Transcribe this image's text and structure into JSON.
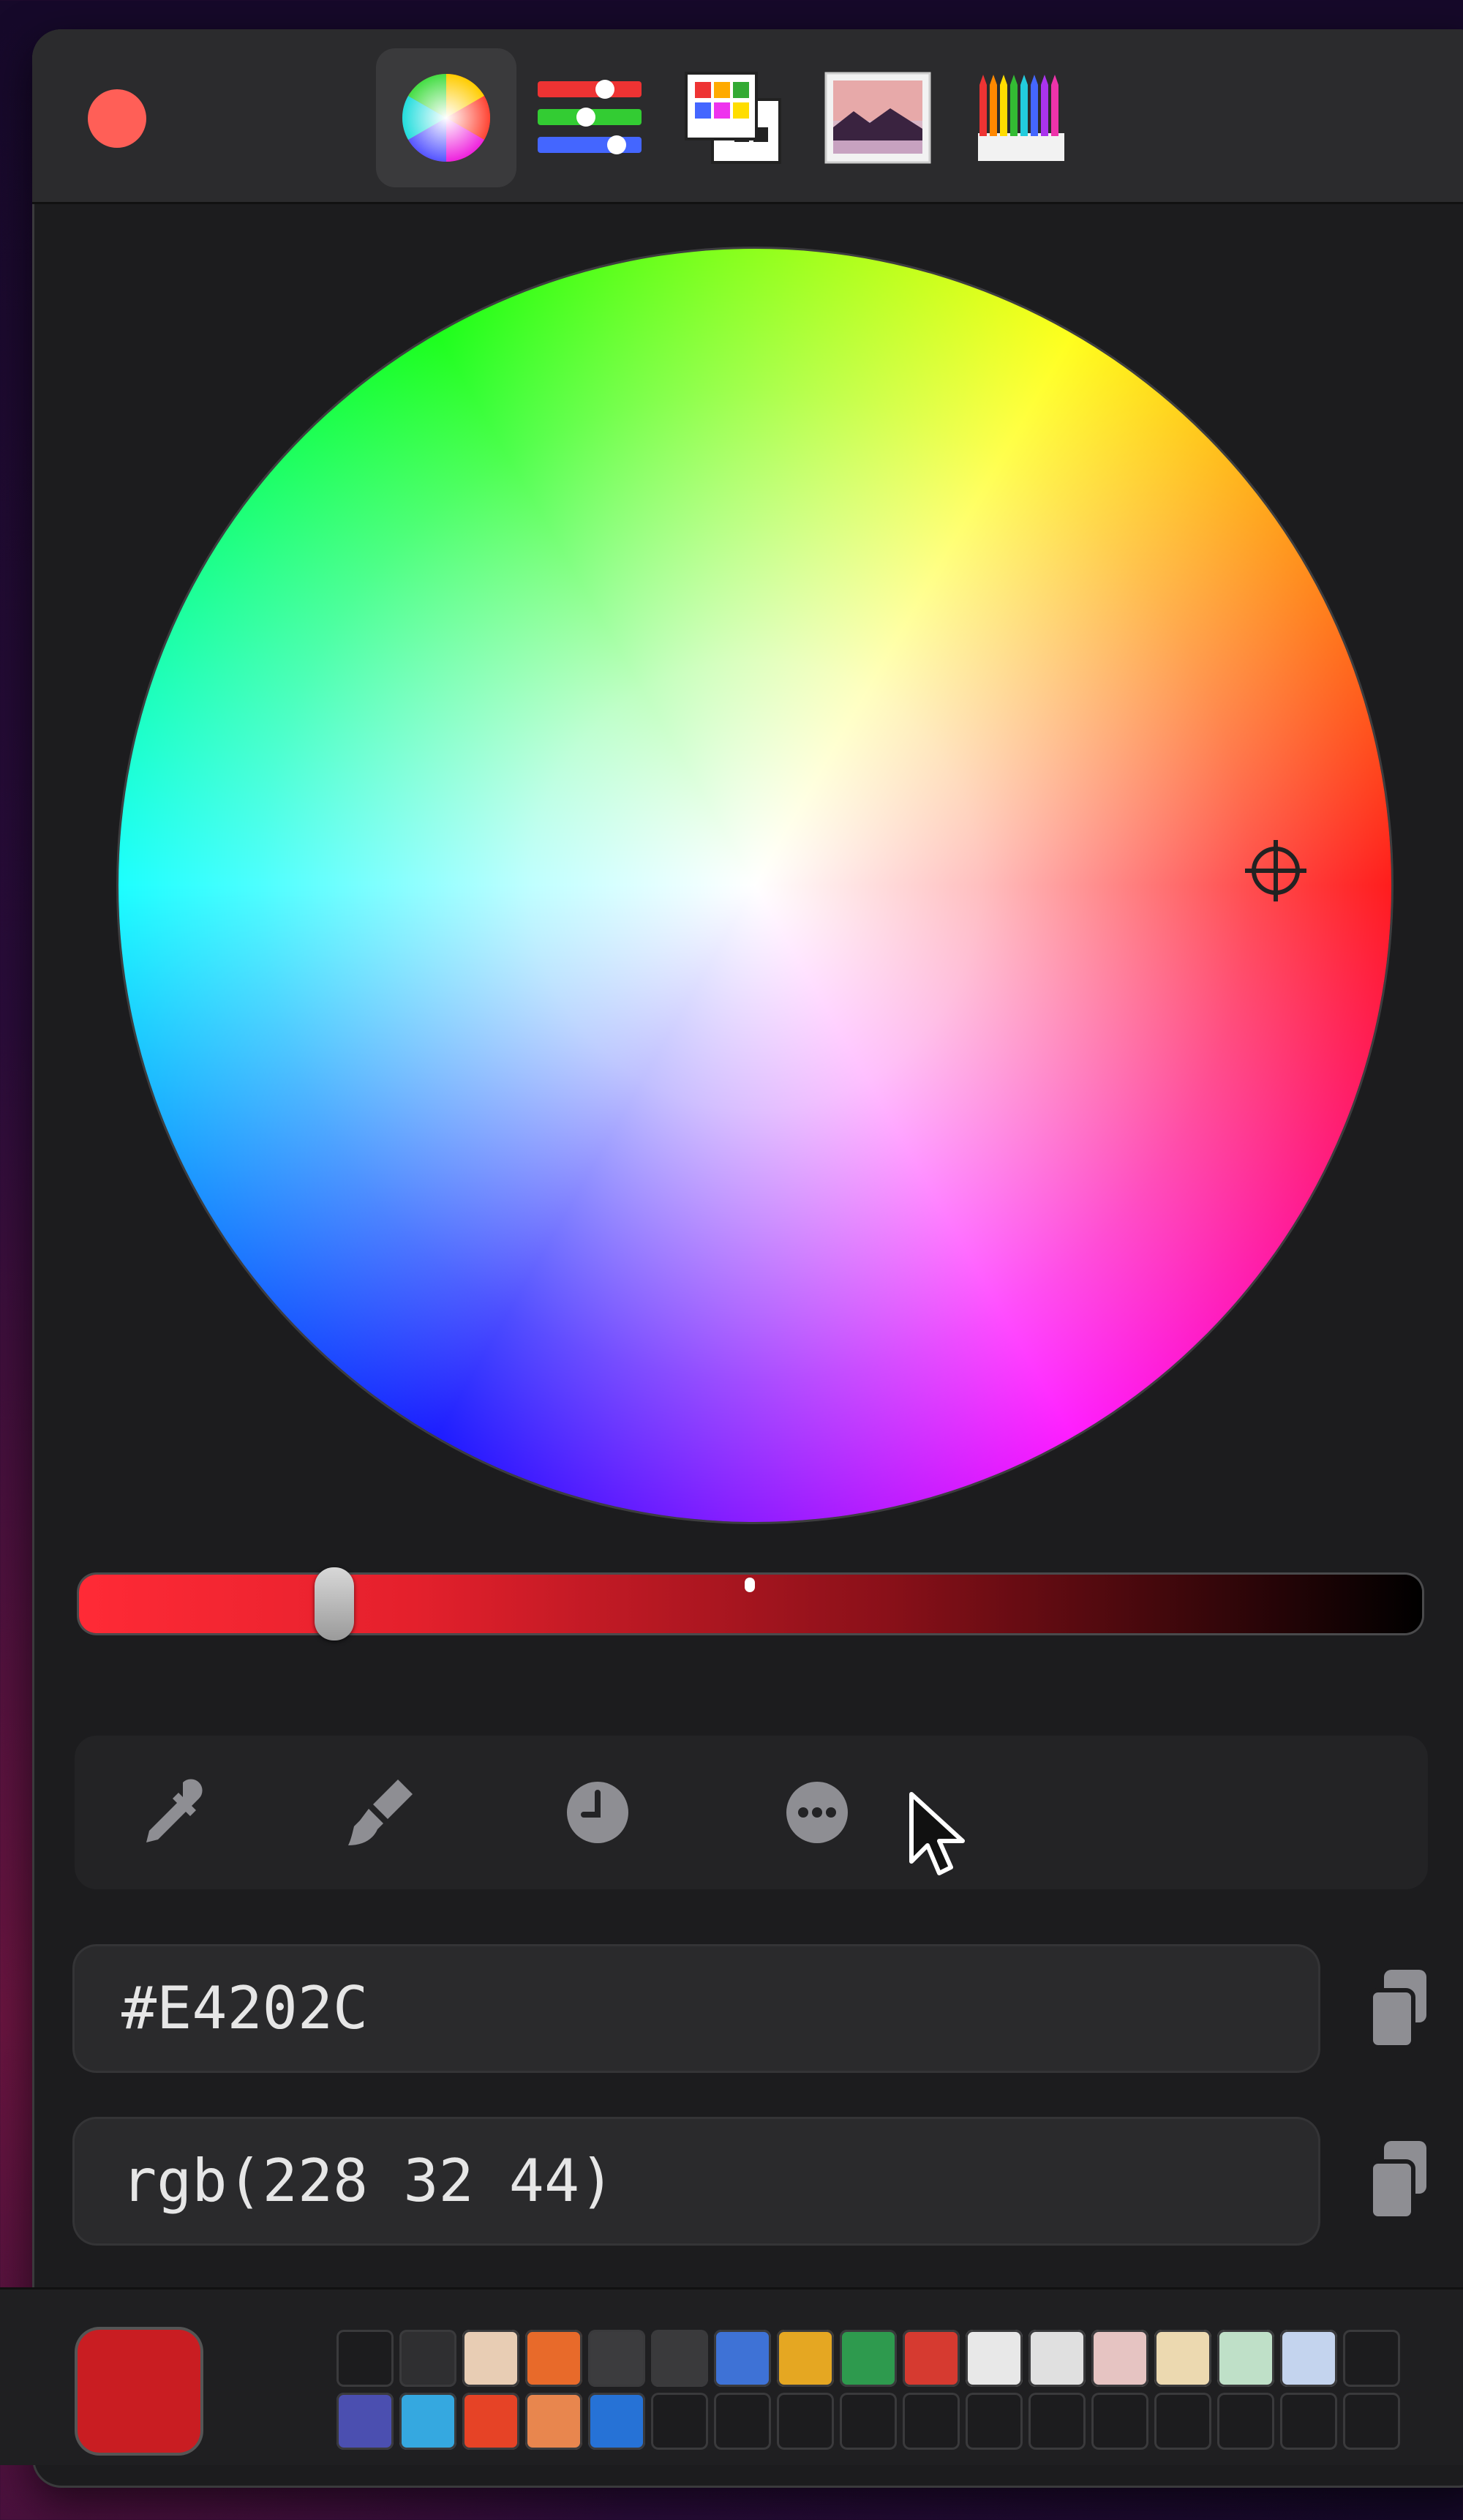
{
  "window": {
    "tabs": [
      {
        "icon": "color-wheel-icon",
        "active": true
      },
      {
        "icon": "color-sliders-icon",
        "active": false
      },
      {
        "icon": "color-palettes-icon",
        "active": false
      },
      {
        "icon": "image-palettes-icon",
        "active": false
      },
      {
        "icon": "pencils-icon",
        "active": false
      }
    ]
  },
  "brightness_slider": {
    "value_fraction": 0.19,
    "colors": [
      "#ff2a36",
      "#000000"
    ]
  },
  "tools": [
    "eyedropper-icon",
    "paint-brush-icon",
    "history-clock-icon",
    "more-options-icon"
  ],
  "fields": {
    "hex_value": "#E4202C",
    "rgb_value": "rgb(228 32 44)"
  },
  "current_color": "#c91d22",
  "swatches": [
    "#1c1c1e",
    "#2f2f31",
    "#e8cdb4",
    "#e86a2a",
    "#3c3c3e",
    "#3a3a3c",
    "#3e72d6",
    "#e5a722",
    "#2e9a4e",
    "#d63a30",
    "#e8e8e8",
    "#e0e0e0",
    "#e6c4c2",
    "#ecd9b0",
    "#bfe0c8",
    "#c4d4ee",
    "#1c1c1e",
    "#4b4fb0",
    "#35a8e0",
    "#e64326",
    "#e8864e",
    "#2672d6",
    "#1c1c1e",
    "#1c1c1e",
    "#1c1c1e",
    "#1c1c1e",
    "#1c1c1e",
    "#1c1c1e",
    "#1c1c1e",
    "#1c1c1e",
    "#1c1c1e",
    "#1c1c1e",
    "#1c1c1e",
    "#1c1c1e"
  ]
}
